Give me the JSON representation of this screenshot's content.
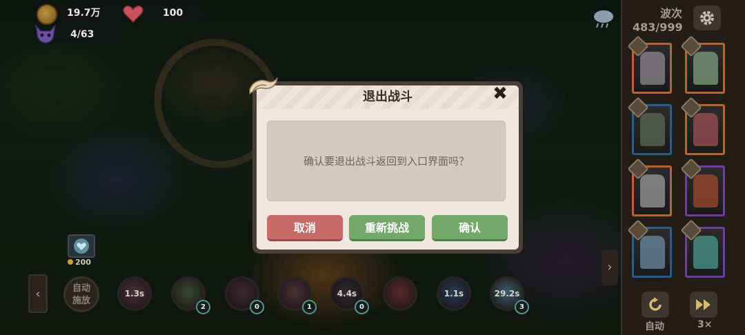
{
  "hud": {
    "gold": "19.7万",
    "hp": "100",
    "enemies": "4/63"
  },
  "sidebar": {
    "wave_label": "波次",
    "wave_count": "483/999",
    "auto_label": "自动",
    "speed_label": "3×",
    "cards": [
      {
        "border": "#b8642c"
      },
      {
        "border": "#b8642c"
      },
      {
        "border": "#2b5d8a"
      },
      {
        "border": "#b8642c"
      },
      {
        "border": "#b8642c"
      },
      {
        "border": "#6f3d9a"
      },
      {
        "border": "#2b5d8a"
      },
      {
        "border": "#6f3d9a"
      }
    ]
  },
  "bottom": {
    "auto_cast": "自动\n施放",
    "shield_cost": "200",
    "slots": [
      {
        "cooldown": "1.3s",
        "count": ""
      },
      {
        "cooldown": "",
        "count": "2"
      },
      {
        "cooldown": "",
        "count": "0"
      },
      {
        "cooldown": "",
        "count": "1"
      },
      {
        "cooldown": "4.4s",
        "count": "0"
      },
      {
        "cooldown": "",
        "count": ""
      },
      {
        "cooldown": "1.1s",
        "count": ""
      },
      {
        "cooldown": "29.2s",
        "count": "3"
      }
    ]
  },
  "modal": {
    "title": "退出战斗",
    "message": "确认要退出战斗返回到入口界面吗？",
    "cancel": "取消",
    "retry": "重新挑战",
    "confirm": "确认"
  },
  "colors": {
    "red_button": "#c96a6a",
    "green_button": "#72a86a",
    "sidebar_bg": "#231d17"
  }
}
